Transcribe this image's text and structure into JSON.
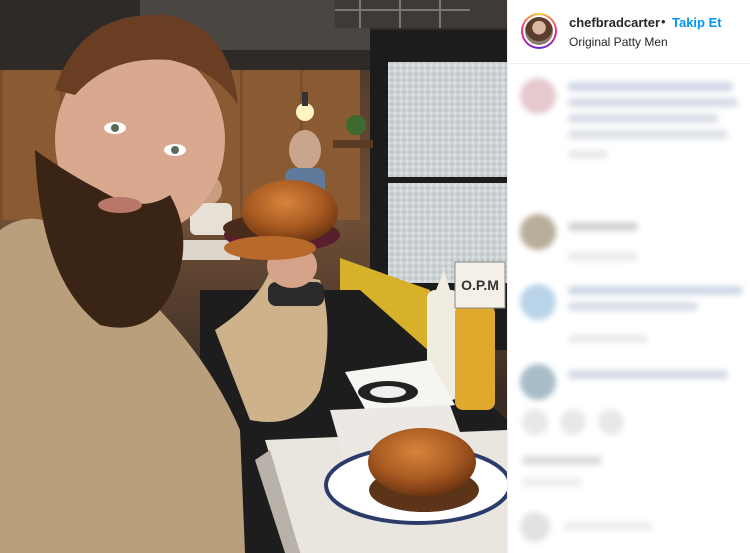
{
  "post": {
    "username": "chefbradcarter",
    "separator": "•",
    "follow_label": "Takip Et",
    "location": "Original Patty Men"
  },
  "photo": {
    "sign_text": "O.P.M"
  },
  "colors": {
    "follow_blue": "#0095f6",
    "text_dark": "#262626",
    "divider": "#efefef"
  },
  "icons": {
    "avatar": "user-avatar-icon"
  }
}
